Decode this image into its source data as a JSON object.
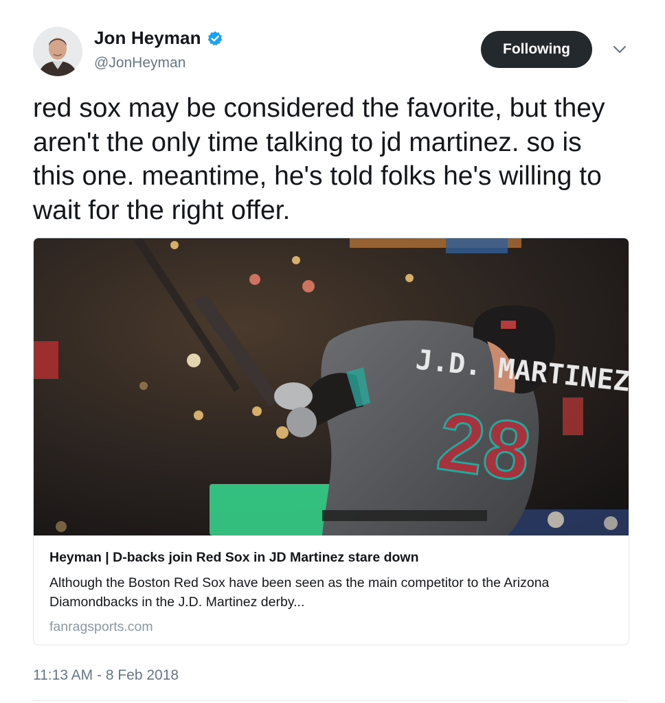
{
  "author": {
    "name": "Jon Heyman",
    "handle": "@JonHeyman",
    "avatar_icon": "profile-photo-icon",
    "verified": true,
    "verified_color": "#1da1f2"
  },
  "follow_button": {
    "label": "Following",
    "bg_color": "#24292e"
  },
  "menu_icon": "chevron-down-icon",
  "tweet": {
    "text": "red sox may be considered the favorite, but they aren't the only time talking to jd martinez. so is this one. meantime, he's told folks he's willing to wait for the right offer."
  },
  "card": {
    "image_jersey_name": "J.D. MARTINEZ",
    "image_jersey_number": "28",
    "title": "Heyman | D-backs join Red Sox in JD Martinez stare down",
    "description": "Although the Boston Red Sox have been seen as the main competitor to the Arizona Diamondbacks in the J.D. Martinez derby...",
    "domain": "fanragsports.com"
  },
  "timestamp": "11:13 AM - 8 Feb 2018"
}
